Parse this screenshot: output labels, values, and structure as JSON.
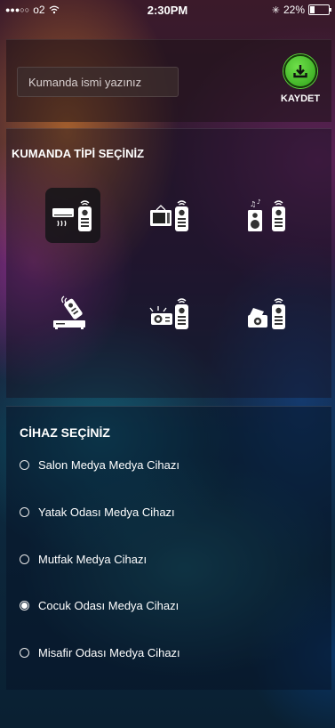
{
  "status_bar": {
    "carrier": "o2",
    "time": "2:30PM",
    "battery": "22%"
  },
  "header": {
    "name_placeholder": "Kumanda ismi yazınız",
    "save_label": "KAYDET"
  },
  "remote_type": {
    "title": "KUMANDA TİPİ SEÇİNİZ",
    "types": [
      {
        "icon": "air-conditioner-remote-icon",
        "selected": true
      },
      {
        "icon": "tv-remote-icon",
        "selected": false
      },
      {
        "icon": "speaker-remote-icon",
        "selected": false
      },
      {
        "icon": "set-top-box-remote-icon",
        "selected": false
      },
      {
        "icon": "projector-remote-icon",
        "selected": false
      },
      {
        "icon": "camera-remote-icon",
        "selected": false
      }
    ]
  },
  "device_select": {
    "title": "CİHAZ SEÇİNİZ",
    "devices": [
      {
        "label": "Salon Medya Medya Cihazı",
        "selected": false
      },
      {
        "label": "Yatak Odası Medya Cihazı",
        "selected": false
      },
      {
        "label": "Mutfak Medya Cihazı",
        "selected": false
      },
      {
        "label": "Cocuk Odası Medya Cihazı",
        "selected": true
      },
      {
        "label": "Misafir Odası Medya Cihazı",
        "selected": false
      }
    ]
  }
}
